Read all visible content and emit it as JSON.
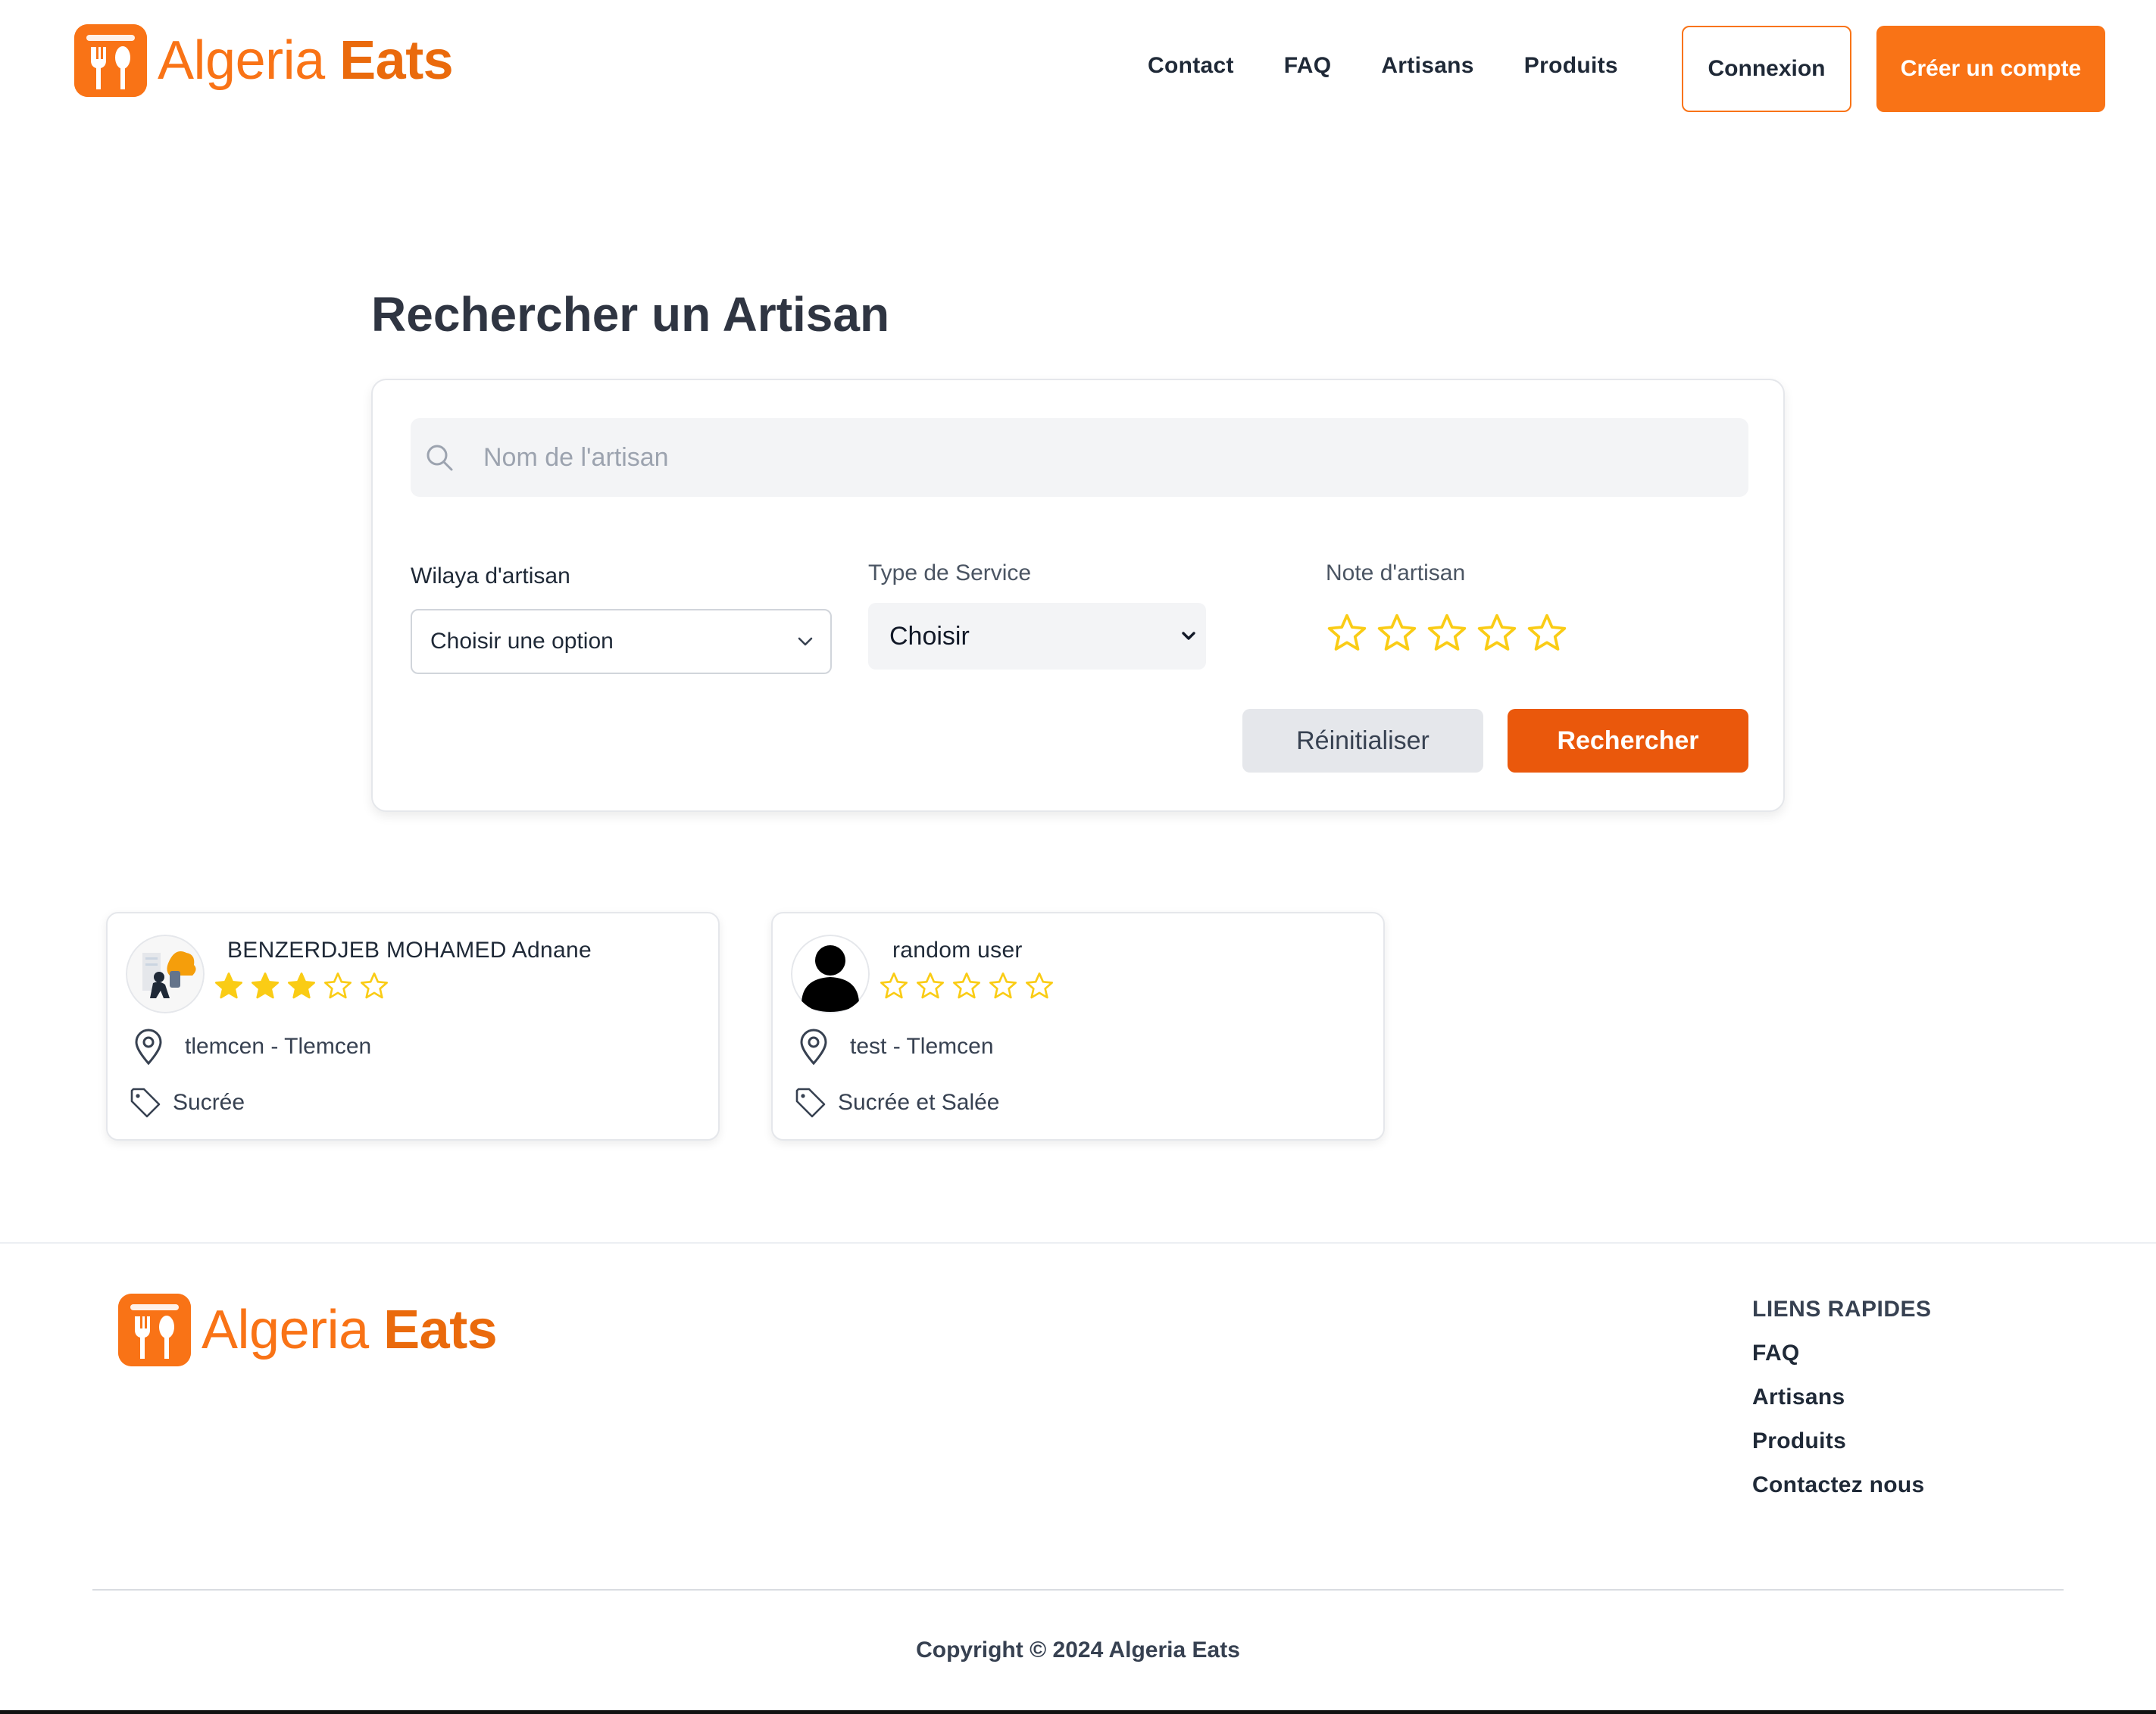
{
  "brand": {
    "name_part1": "Algeria ",
    "name_part2": "Eats",
    "color": "#f97316"
  },
  "nav": {
    "items": [
      "Contact",
      "FAQ",
      "Artisans",
      "Produits"
    ],
    "login_label": "Connexion",
    "signup_label": "Créer un compte"
  },
  "search": {
    "title": "Rechercher un Artisan",
    "name_placeholder": "Nom de l'artisan",
    "wilaya_label": "Wilaya d'artisan",
    "wilaya_value": "Choisir une option",
    "service_label": "Type de Service",
    "service_value": "Choisir",
    "rating_label": "Note d'artisan",
    "rating_value": 0,
    "rating_max": 5,
    "reset_label": "Réinitialiser",
    "search_label": "Rechercher"
  },
  "artisans": [
    {
      "name": "BENZERDJEB MOHAMED Adnane",
      "rating": 3,
      "location": "tlemcen - Tlemcen",
      "service": "Sucrée",
      "avatar": "illustration-avatar"
    },
    {
      "name": "random user",
      "rating": 0,
      "location": "test - Tlemcen",
      "service": "Sucrée et Salée",
      "avatar": "default-user-avatar"
    }
  ],
  "footer": {
    "links_title": "LIENS RAPIDES",
    "links": [
      "FAQ",
      "Artisans",
      "Produits",
      "Contactez nous"
    ],
    "copyright": "Copyright © 2024  Algeria Eats"
  },
  "colors": {
    "accent": "#f97316",
    "search_button": "#ea580c",
    "star": "#facc15"
  }
}
